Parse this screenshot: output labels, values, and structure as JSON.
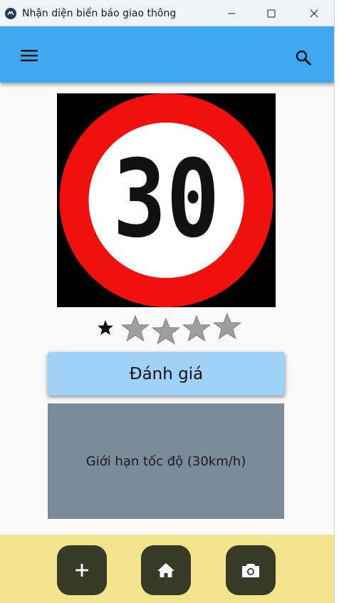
{
  "window": {
    "title": "Nhận diện biển báo giao thông"
  },
  "appbar": {
    "menu_icon": "menu-icon",
    "search_icon": "search-icon",
    "color": "#3ea8f0"
  },
  "sign": {
    "speed_number": "30"
  },
  "rating": {
    "value": 1,
    "max": 5
  },
  "evaluate_button": {
    "label": "Đánh giá"
  },
  "result": {
    "text": "Giới hạn tốc độ (30km/h)"
  },
  "bottom_bar": {
    "buttons": [
      {
        "icon": "add-icon"
      },
      {
        "icon": "home-icon"
      },
      {
        "icon": "camera-icon"
      }
    ]
  }
}
